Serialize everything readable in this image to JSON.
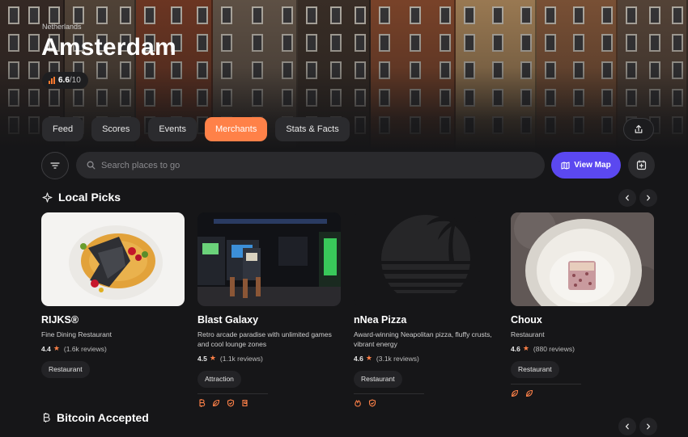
{
  "hero": {
    "country": "Netherlands",
    "city": "Amsterdam",
    "score_value": "6.6",
    "score_max": "/10",
    "score_icon": "bar-chart-icon"
  },
  "tabs": [
    {
      "label": "Feed",
      "active": false
    },
    {
      "label": "Scores",
      "active": false
    },
    {
      "label": "Events",
      "active": false
    },
    {
      "label": "Merchants",
      "active": true
    },
    {
      "label": "Stats & Facts",
      "active": false
    }
  ],
  "search": {
    "placeholder": "Search places to go",
    "view_map_label": "View Map"
  },
  "sections": {
    "local_picks": "Local Picks",
    "bitcoin_accepted": "Bitcoin Accepted"
  },
  "cards": [
    {
      "name": "RIJKS®",
      "desc": "Fine Dining Restaurant",
      "rating": "4.4",
      "reviews": "(1.6k reviews)",
      "tag": "Restaurant",
      "icons": []
    },
    {
      "name": "Blast Galaxy",
      "desc": "Retro arcade paradise with unlimited games and cool lounge zones",
      "rating": "4.5",
      "reviews": "(1.1k reviews)",
      "tag": "Attraction",
      "icons": [
        "bitcoin-icon",
        "leaf-icon",
        "shield-icon",
        "card-icon"
      ]
    },
    {
      "name": "nNea Pizza",
      "desc": "Award-winning Neapolitan pizza, fluffy crusts, vibrant energy",
      "rating": "4.6",
      "reviews": "(3.1k reviews)",
      "tag": "Restaurant",
      "icons": [
        "flame-icon",
        "shield-icon"
      ]
    },
    {
      "name": "Choux",
      "desc": "Restaurant",
      "rating": "4.6",
      "reviews": "(880 reviews)",
      "tag": "Restaurant",
      "icons": [
        "leaf-icon",
        "leaf-icon"
      ]
    }
  ],
  "colors": {
    "accent": "#ff8148",
    "map_button": "#5b48f0",
    "background": "#161618"
  }
}
